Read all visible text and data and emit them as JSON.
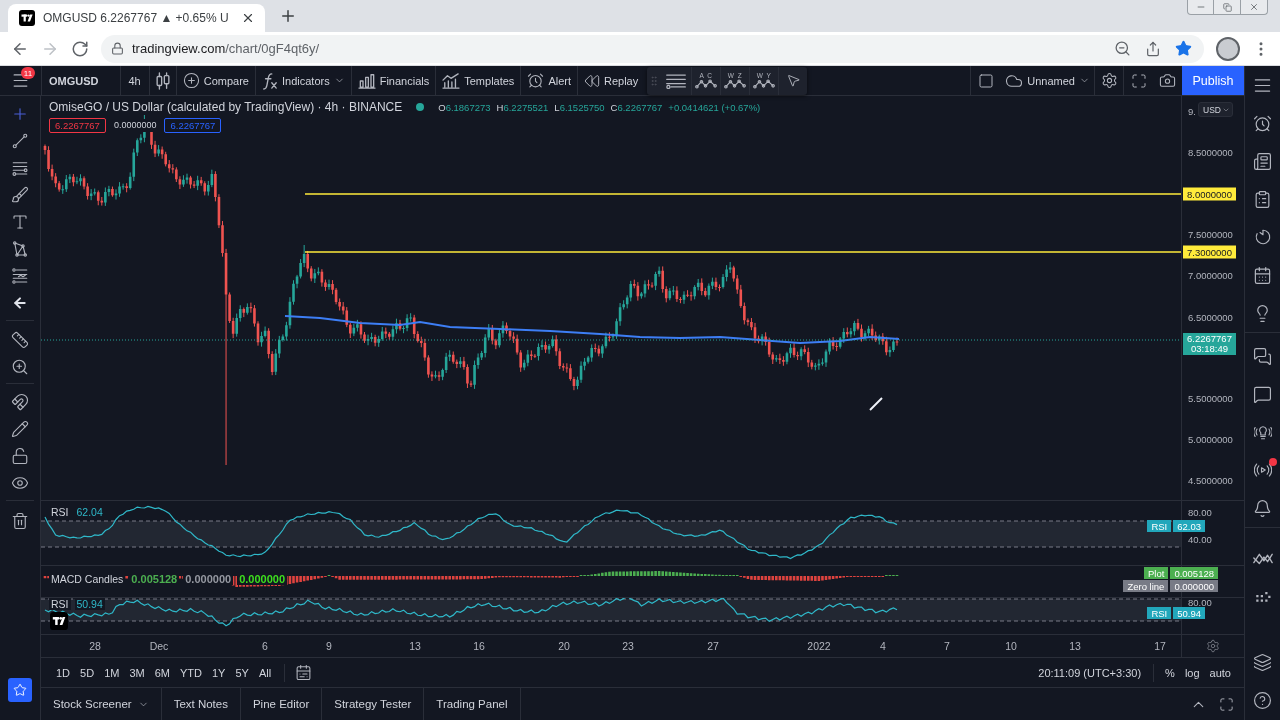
{
  "browser": {
    "tab": {
      "title": "OMGUSD 6.2267767 ▲ +0.65% U"
    },
    "nav": [
      {
        "kind": "back",
        "disabled": false
      },
      {
        "kind": "forward",
        "disabled": true
      },
      {
        "kind": "reload",
        "disabled": false
      }
    ],
    "url": {
      "host": "tradingview.com",
      "path": "/chart/0gF4qt6y/"
    },
    "bookmarked": true
  },
  "toolbar": {
    "menu_badge": "11",
    "symbol": "OMGUSD",
    "interval": "4h",
    "items": [
      {
        "kind": "compare",
        "label": "Compare"
      },
      {
        "kind": "indicators",
        "label": "Indicators"
      },
      {
        "kind": "financials",
        "label": "Financials"
      },
      {
        "kind": "templates",
        "label": "Templates"
      },
      {
        "kind": "alert",
        "label": "Alert"
      },
      {
        "kind": "replay",
        "label": "Replay"
      }
    ],
    "patterns": [
      "A C",
      "W Z",
      "W Y"
    ],
    "layout_name": "Unnamed",
    "publish": "Publish"
  },
  "legend": {
    "title": "OmiseGO / US Dollar (calculated by TradingView) · 4h · BINANCE",
    "market_open": true,
    "ohlc": [
      {
        "key": "O",
        "value": "6.1867273"
      },
      {
        "key": "H",
        "value": "6.2275521"
      },
      {
        "key": "L",
        "value": "6.1525750"
      },
      {
        "key": "C",
        "value": "6.2267767"
      }
    ],
    "change": "+0.0414621 (+0.67%)"
  },
  "trade": {
    "sell": "6.2267767",
    "spread": "0.0000000",
    "buy": "6.2267767"
  },
  "price_axis": {
    "currency": "USD",
    "ticks": [
      "9.",
      "8.5000000",
      "7.5000000",
      "7.0000000",
      "6.5000000",
      "5.5000000",
      "5.0000000",
      "4.5000000"
    ],
    "levels": [
      "8.0000000",
      "7.3000000"
    ],
    "last_price": "6.2267767",
    "countdown": "03:18:49"
  },
  "panes": [
    {
      "kind": "rsi",
      "title": "RSI",
      "value": "62.04",
      "axis": [
        "80.00",
        "40.00"
      ],
      "badge": {
        "title": "RSI",
        "value": "62.03"
      }
    },
    {
      "kind": "macd",
      "title": "MACD Candles",
      "values": [
        {
          "text": "0.005128",
          "color": "#4caf50"
        },
        {
          "text": "0.000000",
          "color": "#9598a1"
        },
        {
          "text": "0.000000",
          "color": "#3ee01e"
        }
      ],
      "badges": [
        {
          "title": "Plot",
          "value": "0.005128",
          "color": "#4caf50"
        },
        {
          "title": "Zero line",
          "value": "0.000000",
          "color": "#787b86"
        }
      ]
    },
    {
      "kind": "rsi",
      "title": "RSI",
      "value": "50.94",
      "axis": [
        "80.00"
      ],
      "badge": {
        "title": "RSI",
        "value": "50.94"
      }
    }
  ],
  "time_axis": [
    "28",
    "Dec",
    "6",
    "9",
    "13",
    "16",
    "20",
    "23",
    "27",
    "2022",
    "4",
    "7",
    "10",
    "13",
    "17"
  ],
  "range_bar": {
    "ranges": [
      "1D",
      "5D",
      "1M",
      "3M",
      "6M",
      "YTD",
      "1Y",
      "5Y",
      "All"
    ],
    "clock": "20:11:09 (UTC+3:30)",
    "scale_options": [
      "%",
      "log",
      "auto"
    ]
  },
  "bottom_tabs": [
    {
      "label": "Stock Screener",
      "has_menu": true
    },
    {
      "label": "Text Notes",
      "has_menu": false
    },
    {
      "label": "Pine Editor",
      "has_menu": false
    },
    {
      "label": "Strategy Tester",
      "has_menu": false
    },
    {
      "label": "Trading Panel",
      "has_menu": false
    }
  ],
  "sidebar": {
    "stream_notification": true
  }
}
